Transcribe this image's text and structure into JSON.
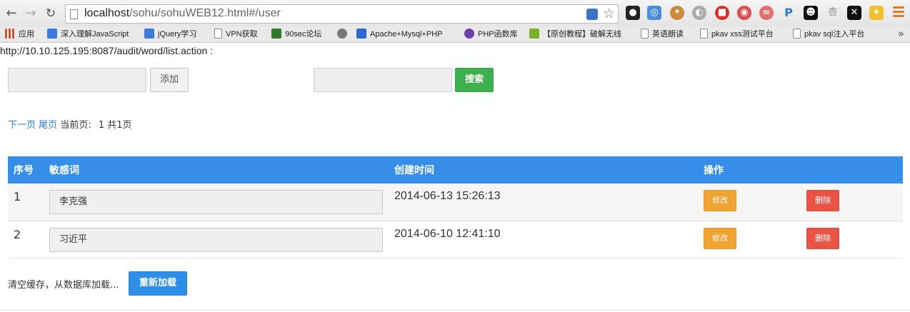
{
  "browser": {
    "url_host": "localhost",
    "url_path": "/sohu/sohuWEB12.html#/user",
    "bookmarks": [
      {
        "label": "应用",
        "color": "#d5512b"
      },
      {
        "label": "深入理解JavaScript",
        "color": "#3d7bd8"
      },
      {
        "label": "jQuery学习",
        "color": "#3d7bd8"
      },
      {
        "label": "VPN获取",
        "color": "#ffffff"
      },
      {
        "label": "90sec论坛",
        "color": "#2f7a2f"
      },
      {
        "label": "",
        "color": "#777777"
      },
      {
        "label": "Apache+Mysql+PHP",
        "color": "#2a6bd1"
      },
      {
        "label": "PHP函数库",
        "color": "#6e3fa8"
      },
      {
        "label": "【原创教程】破解无线",
        "color": "#7ab22c"
      },
      {
        "label": "英语朗读",
        "color": "#ffffff"
      },
      {
        "label": "pkav xss测试平台",
        "color": "#ffffff"
      },
      {
        "label": "pkav sql注入平台",
        "color": "#ffffff"
      }
    ],
    "more": "»"
  },
  "page": {
    "endpoint": "http://10.10.125.195:8087/audit/word/list.action :",
    "add_input_value": "",
    "add_button": "添加",
    "search_input_value": "",
    "search_button": "搜索",
    "pager": {
      "next": "下一页",
      "last": "尾页",
      "current_label": "当前页:",
      "current_page": "1",
      "total": "共1页"
    },
    "table": {
      "headers": [
        "序号",
        "敏感词",
        "创建时间",
        "操作"
      ],
      "rows": [
        {
          "index": "1",
          "word": "李克强",
          "created": "2014-06-13 15:26:13",
          "edit": "修改",
          "delete": "删除"
        },
        {
          "index": "2",
          "word": "习近平",
          "created": "2014-06-10 12:41:10",
          "edit": "修改",
          "delete": "删除"
        }
      ]
    },
    "reload_text": "清空缓存，从数据库加载...",
    "reload_button": "重新加载"
  },
  "colors": {
    "table_header": "#368ee8",
    "search_button": "#3cb04c",
    "edit_button": "#f0a32e",
    "delete_button": "#ea5445",
    "reload_button": "#2e8ee6",
    "link": "#2a7fd4"
  }
}
